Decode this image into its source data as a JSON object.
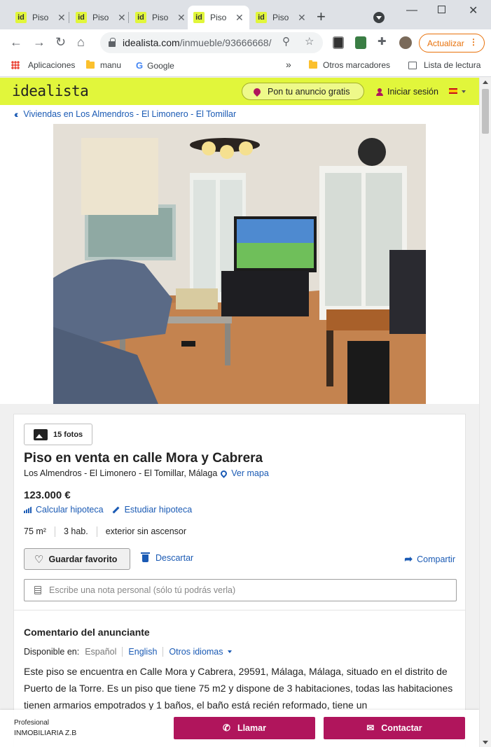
{
  "browser": {
    "tabs": [
      {
        "favicon": "id",
        "title": "Piso"
      },
      {
        "favicon": "id",
        "title": "Piso"
      },
      {
        "favicon": "id",
        "title": "Piso"
      },
      {
        "favicon": "id",
        "title": "Piso"
      },
      {
        "favicon": "id",
        "title": "Piso"
      }
    ],
    "url_host": "idealista.com",
    "url_path": "/inmueble/93666668/",
    "update_label": "Actualizar",
    "bookmarks": {
      "apps": "Aplicaciones",
      "manu": "manu",
      "google": "Google",
      "overflow": "»",
      "other": "Otros marcadores",
      "reading_list": "Lista de lectura"
    }
  },
  "site": {
    "logo": "idealista",
    "post_ad": "Pon tu anuncio gratis",
    "login": "Iniciar sesión",
    "breadcrumb": "Viviendas en Los Almendros - El Limonero - El Tomillar"
  },
  "listing": {
    "photos_label": "15 fotos",
    "title": "Piso en venta en calle Mora y Cabrera",
    "location": "Los Almendros - El Limonero - El Tomillar, Málaga",
    "map_link": "Ver mapa",
    "price": "123.000 €",
    "calc_mortgage": "Calcular hipoteca",
    "study_mortgage": "Estudiar hipoteca",
    "features": [
      "75 m²",
      "3 hab.",
      "exterior sin ascensor"
    ],
    "favorite_label": "Guardar favorito",
    "discard_label": "Descartar",
    "share_label": "Compartir",
    "note_placeholder": "Escribe una nota personal (sólo tú podrás verla)",
    "comment_title": "Comentario del anunciante",
    "available_in": "Disponible en:",
    "lang_current": "Español",
    "lang_alt": "English",
    "lang_more": "Otros idiomas",
    "description": "Este piso se encuentra en Calle Mora y Cabrera, 29591, Málaga, Málaga, situado en el distrito de Puerto de la Torre. Es un piso que tiene 75 m2 y dispone de 3 habitaciones, todas las habitaciones tienen armarios empotrados y 1 baños, el baño está recién reformado, tiene un"
  },
  "contact_bar": {
    "pro_label": "Profesional",
    "agency": "INMOBILIARIA Z.B",
    "call_label": "Llamar",
    "contact_label": "Contactar"
  },
  "colors": {
    "brand_yellow": "#e1f63b",
    "brand_magenta": "#b0155c",
    "link_blue": "#1a5ab4",
    "update_orange": "#e8710a"
  }
}
